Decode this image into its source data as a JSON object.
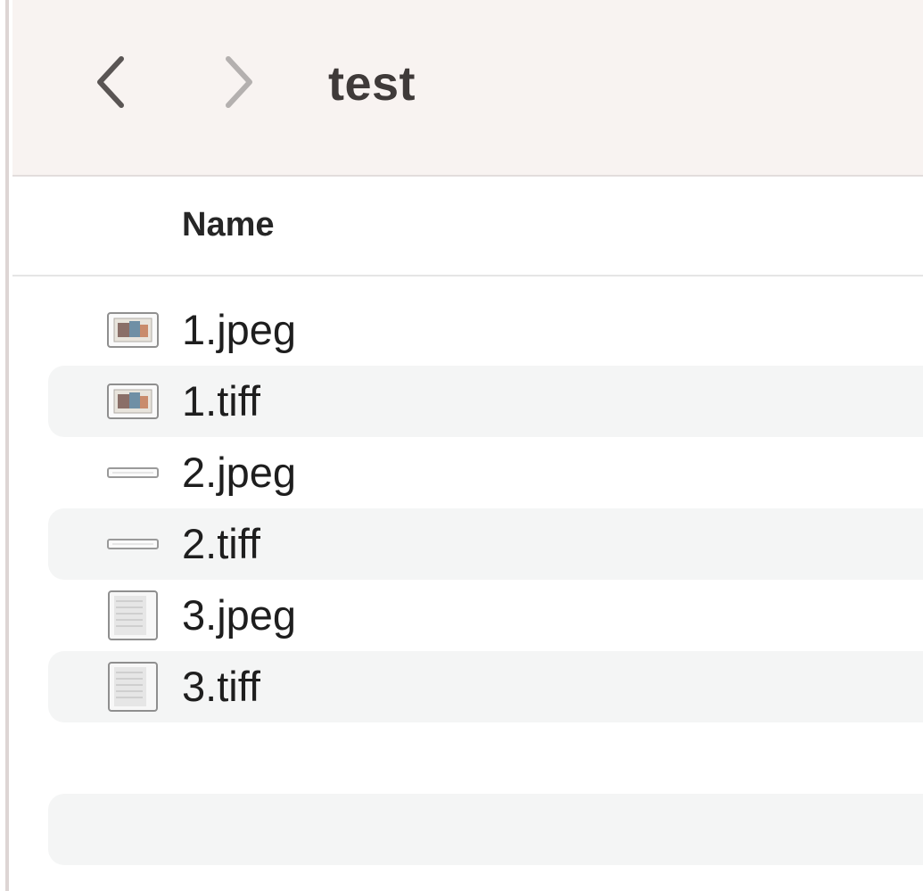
{
  "window": {
    "title": "test"
  },
  "toolbar": {
    "back_icon": "chevron-left-icon",
    "forward_icon": "chevron-right-icon"
  },
  "list_header": {
    "name_label": "Name"
  },
  "files": [
    {
      "name": "1.jpeg",
      "icon": "image-thumbnail-icon"
    },
    {
      "name": "1.tiff",
      "icon": "image-thumbnail-icon"
    },
    {
      "name": "2.jpeg",
      "icon": "thin-strip-thumbnail-icon"
    },
    {
      "name": "2.tiff",
      "icon": "thin-strip-thumbnail-icon"
    },
    {
      "name": "3.jpeg",
      "icon": "document-thumbnail-icon"
    },
    {
      "name": "3.tiff",
      "icon": "document-thumbnail-icon"
    }
  ],
  "colors": {
    "toolbar_bg": "#f8f3f1",
    "row_alt_bg": "#f4f5f5",
    "title_text": "#3f3a39"
  }
}
